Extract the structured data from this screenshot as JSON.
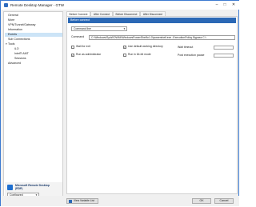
{
  "window": {
    "title": "Remote Desktop Manager - GTW",
    "minimize_icon": "minimize-icon",
    "maximize_icon": "maximize-icon",
    "close_icon": "close-icon"
  },
  "sidebar": {
    "items": [
      {
        "label": "General"
      },
      {
        "label": "More"
      },
      {
        "label": "VPN/Tunnel/Gateway"
      },
      {
        "label": "Information"
      },
      {
        "label": "Events",
        "selected": true
      },
      {
        "label": "Sub Connections"
      },
      {
        "label": "Tools",
        "expander": "▾"
      },
      {
        "label": "iLO"
      },
      {
        "label": "Intel® AMT"
      },
      {
        "label": "Sessions"
      },
      {
        "label": "Advanced"
      }
    ],
    "connection": {
      "title_line1": "Microsoft Remote Desktop",
      "title_line2": "(RDP)",
      "combo_value": "Configured",
      "icon": "rdp-icon"
    }
  },
  "tabs": [
    "Before Connect",
    "After Connect",
    "Before Disconnect",
    "After Disconnect"
  ],
  "events": {
    "section_title": "Before connect",
    "type_value": "Command line",
    "command_label": "Command",
    "command_value": "C:\\Windows\\SysWOW64\\WindowsPowerShell\\v1.0\\powershell.exe -ExecutionPolicy Bypass C:\\",
    "checkboxes": {
      "wait_for_exit": {
        "label": "Wait for exit",
        "checked": false
      },
      "use_default_dir": {
        "label": "Use default working directory",
        "checked": true
      },
      "run_as_admin": {
        "label": "Run as administrator",
        "checked": true
      },
      "run_in_64bit": {
        "label": "Run in 64-bit mode",
        "checked": false
      }
    },
    "wait_timeout_label": "Wait timeout",
    "post_exec_pause_label": "Post execution pause"
  },
  "footer": {
    "view_variable_list": "View Variable List",
    "ok": "OK",
    "cancel": "Cancel"
  },
  "colors": {
    "accent": "#2b68b5",
    "selection": "#cce4f7",
    "window_border": "#3c7ad0"
  }
}
